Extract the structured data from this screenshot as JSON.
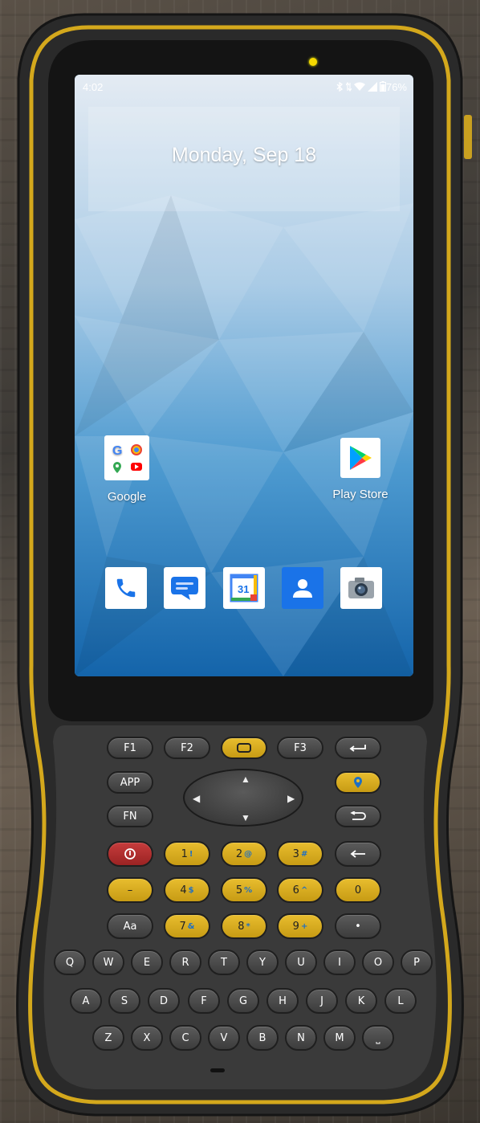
{
  "status_bar": {
    "time": "4:02",
    "battery": "76%",
    "icons": [
      "bluetooth-icon",
      "data-arrows-icon",
      "wifi-icon",
      "signal-icon",
      "battery-icon"
    ]
  },
  "widget": {
    "date": "Monday, Sep 18"
  },
  "apps": [
    {
      "label": "Google",
      "icon": "google-folder-icon"
    },
    {
      "label": "Play Store",
      "icon": "play-store-icon"
    }
  ],
  "dock": [
    "phone-icon",
    "messages-icon",
    "calendar-icon",
    "contacts-icon",
    "camera-icon"
  ],
  "calendar_day": "31",
  "keypad": {
    "row1": [
      "F1",
      "F2",
      "",
      "F3",
      ""
    ],
    "row2": [
      "APP",
      ""
    ],
    "row3": [
      "FN",
      ""
    ],
    "numbers": [
      {
        "main": "1",
        "sub": "!"
      },
      {
        "main": "2",
        "sub": "@"
      },
      {
        "main": "3",
        "sub": "#"
      },
      {
        "main": "–",
        "sub": ""
      },
      {
        "main": "4",
        "sub": "$"
      },
      {
        "main": "5",
        "sub": "%"
      },
      {
        "main": "6",
        "sub": "^"
      },
      {
        "main": "0",
        "sub": ""
      },
      {
        "main": "7",
        "sub": "&"
      },
      {
        "main": "8",
        "sub": "*"
      },
      {
        "main": "9",
        "sub": "+"
      }
    ],
    "aa": "Aa",
    "dot": "•",
    "letters_row1": [
      "Q",
      "W",
      "E",
      "R",
      "T",
      "Y",
      "U",
      "I",
      "O",
      "P"
    ],
    "letters_row2": [
      "A",
      "S",
      "D",
      "F",
      "G",
      "H",
      "J",
      "K",
      "L"
    ],
    "letters_row3": [
      "Z",
      "X",
      "C",
      "V",
      "B",
      "N",
      "M",
      "⎵"
    ]
  },
  "colors": {
    "accent_yellow": "#d9ad1f",
    "power_red": "#b83030",
    "wallpaper_blue": "#3f8fc8"
  }
}
